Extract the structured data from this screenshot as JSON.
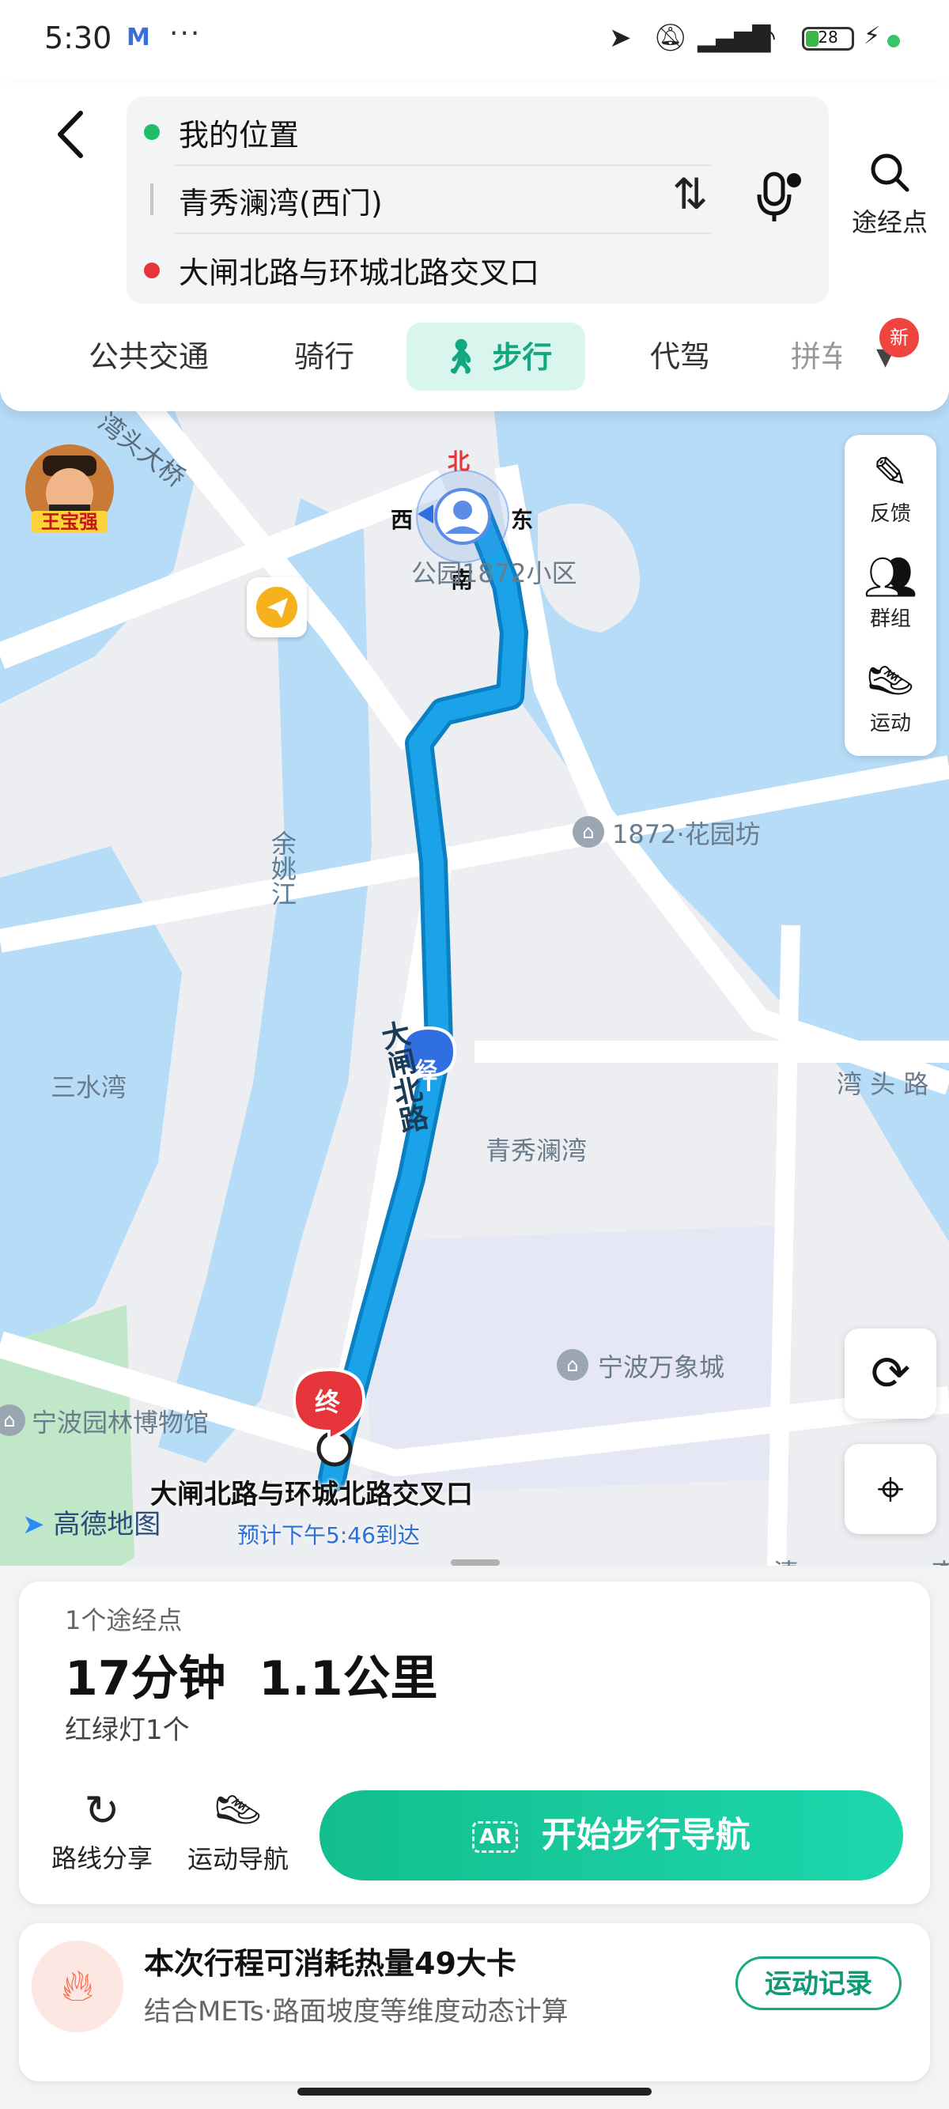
{
  "status_bar": {
    "time": "5:30",
    "carrier_icon": "M",
    "more": "···",
    "battery_level": "28",
    "battery_fraction": 0.28,
    "icons": [
      "location-arrow-icon",
      "mute-icon",
      "signal-icon",
      "wifi-icon",
      "battery-icon",
      "charging-icon"
    ]
  },
  "route": {
    "origin": "我的位置",
    "via": "青秀澜湾(西门)",
    "destination": "大闸北路与环城北路交叉口"
  },
  "header": {
    "waypoint_label": "途经点"
  },
  "tabs": {
    "items": [
      "公共交通",
      "骑行",
      "步行",
      "代驾",
      "拼车"
    ],
    "partial_last": "拼⺸",
    "active": "步行",
    "new_badge": "新"
  },
  "map": {
    "compass": {
      "north": "北",
      "south": "南",
      "east": "东",
      "west": "西"
    },
    "labels": {
      "bridge": "湾头大桥",
      "residential_1872": "公园1872小区",
      "huayuanfang": "1872·花园坊",
      "river": "余姚江",
      "sanshuiwan": "三水湾",
      "qingxiu": "青秀澜湾",
      "wantou_road": "湾 头 路",
      "dazha_road": "大闸北路",
      "wanxiangcheng": "宁波万象城",
      "museum": "宁波园林博物馆",
      "qing": "清",
      "li": "李"
    },
    "via_marker": "经",
    "end_marker": "终",
    "end_label": "大闸北路与环城北路交叉口",
    "eta": "预计下午5:46到达",
    "brand": "高德地图",
    "avatar_tag": "王宝强",
    "side_panel": [
      {
        "label": "反馈",
        "icon": "pen-icon"
      },
      {
        "label": "群组",
        "icon": "group-icon"
      },
      {
        "label": "运动",
        "icon": "running-shoe-icon"
      }
    ]
  },
  "route_card": {
    "waypoints_count": "1个途经点",
    "duration_distance": "17分钟  1.1公里",
    "traffic_lights": "红绿灯1个",
    "share_label": "路线分享",
    "sport_nav_label": "运动导航",
    "start_button": "开始步行导航",
    "ar_badge": "AR"
  },
  "calorie_card": {
    "title": "本次行程可消耗热量49大卡",
    "subtitle": "结合METs·路面坡度等维度动态计算",
    "button": "运动记录"
  },
  "colors": {
    "accent_green": "#13be8e",
    "route_blue": "#1aa3e8",
    "water_blue": "#b7dcf8",
    "end_red": "#e6353a"
  }
}
